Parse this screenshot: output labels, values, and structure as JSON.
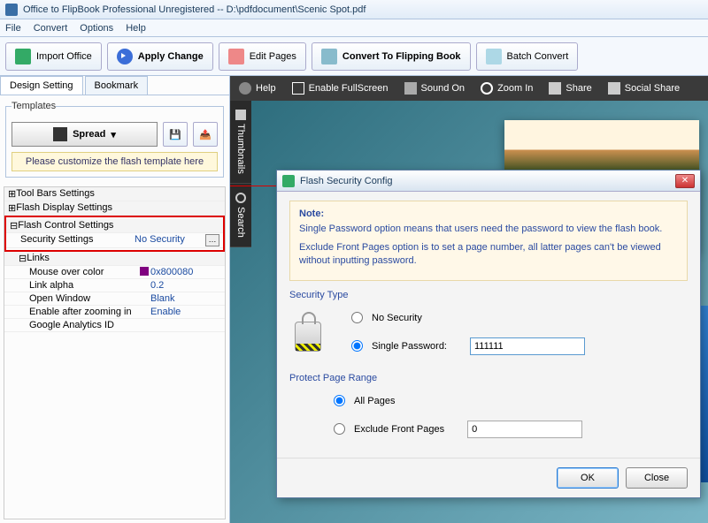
{
  "window": {
    "title": "Office to FlipBook Professional Unregistered -- D:\\pdfdocument\\Scenic Spot.pdf"
  },
  "menus": {
    "file": "File",
    "convert": "Convert",
    "options": "Options",
    "help": "Help"
  },
  "toolbar": {
    "import": "Import Office",
    "apply": "Apply Change",
    "edit": "Edit Pages",
    "flip": "Convert To Flipping Book",
    "batch": "Batch Convert"
  },
  "left": {
    "tabs": {
      "design": "Design Setting",
      "bookmark": "Bookmark"
    },
    "templates_label": "Templates",
    "spread": "Spread",
    "customize_msg": "Please customize the flash template here",
    "tree": {
      "tool_bars": "Tool Bars Settings",
      "flash_display": "Flash Display Settings",
      "flash_control": "Flash Control Settings",
      "security_lbl": "Security Settings",
      "security_val": "No Security",
      "links": "Links",
      "mouse_lbl": "Mouse over color",
      "mouse_val": "0x800080",
      "alpha_lbl": "Link alpha",
      "alpha_val": "0.2",
      "open_lbl": "Open Window",
      "open_val": "Blank",
      "zoom_lbl": "Enable after zooming in",
      "zoom_val": "Enable",
      "ga_lbl": "Google Analytics ID"
    }
  },
  "topstrip": {
    "help": "Help",
    "fullscreen": "Enable FullScreen",
    "sound": "Sound On",
    "zoom": "Zoom In",
    "share": "Share",
    "social": "Social Share"
  },
  "sidetabs": {
    "thumbs": "Thumbnails",
    "search": "Search"
  },
  "dialog": {
    "title": "Flash Security Config",
    "note_hd": "Note:",
    "note1": "Single Password option means that users need the password to view the flash book.",
    "note2": "Exclude Front Pages option is to set a page number, all latter pages can't be viewed without inputting password.",
    "sectype": "Security Type",
    "nosec": "No Security",
    "singlepw": "Single Password:",
    "pw_value": "111111",
    "protect": "Protect Page Range",
    "allpages": "All Pages",
    "exclude": "Exclude Front Pages",
    "exclude_val": "0",
    "ok": "OK",
    "close": "Close"
  }
}
